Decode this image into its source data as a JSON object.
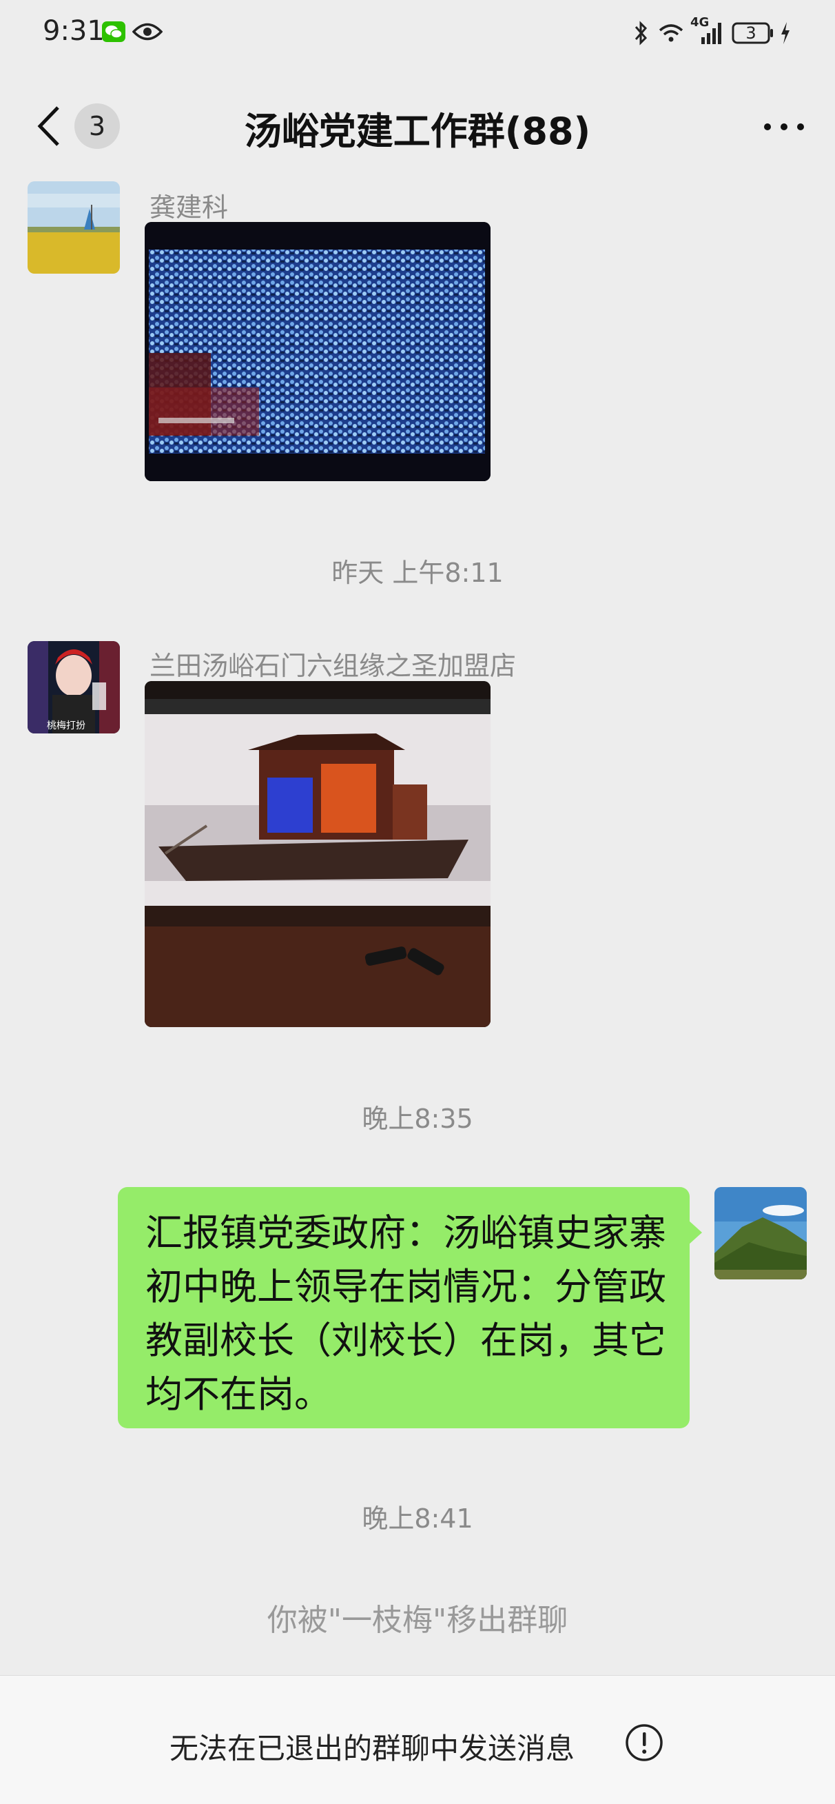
{
  "status_bar": {
    "time": "9:31",
    "icons": [
      "wechat-icon",
      "eye-icon",
      "bluetooth-icon",
      "wifi-icon",
      "signal-4g-icon",
      "battery-icon",
      "charging-icon"
    ],
    "network_label": "4G",
    "battery_level": "3"
  },
  "nav": {
    "back_icon": "chevron-left-icon",
    "unread_count": "3",
    "title": "汤峪党建工作群(88)",
    "more_icon": "more-dots-icon"
  },
  "messages": [
    {
      "type": "image",
      "sender": "龚建科",
      "image_desc": "crowd-hall-photo"
    },
    {
      "type": "time",
      "text": "昨天 上午8:11"
    },
    {
      "type": "image",
      "sender": "兰田汤峪石门六组缘之圣加盟店",
      "image_desc": "red-boat-photo",
      "avatar_text": "桃梅打扮"
    },
    {
      "type": "time",
      "text": "晚上8:35"
    },
    {
      "type": "text",
      "self": true,
      "text": "汇报镇党委政府：汤峪镇史家寨初中晚上领导在岗情况：分管政教副校长（刘校长）在岗，其它均不在岗。"
    },
    {
      "type": "time",
      "text": "晚上8:41"
    },
    {
      "type": "system",
      "text": "你被\"一枝梅\"移出群聊"
    }
  ],
  "bottom_bar": {
    "text": "无法在已退出的群聊中发送消息",
    "icon": "exclamation-circle-icon"
  },
  "colors": {
    "background": "#ededed",
    "self_bubble": "#95ec69",
    "meta_text": "#8a8a8a",
    "bottom_bar": "#f7f7f7"
  }
}
